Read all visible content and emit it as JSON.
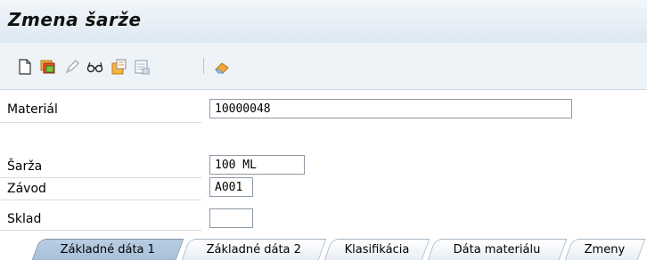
{
  "window": {
    "title": "Zmena šarže"
  },
  "toolbar": {
    "icons": [
      "new-document-icon",
      "save-icon",
      "pencil-icon",
      "glasses-icon",
      "copy-icon",
      "print-preview-icon",
      "eraser-icon"
    ]
  },
  "form": {
    "material": {
      "label": "Materiál",
      "value": "10000048"
    },
    "batch": {
      "label": "Šarža",
      "value": "100 ML"
    },
    "plant": {
      "label": "Závod",
      "value": "A001"
    },
    "storage": {
      "label": "Sklad",
      "value": ""
    }
  },
  "tabs": [
    {
      "label": "Základné dáta 1",
      "active": true
    },
    {
      "label": "Základné dáta 2",
      "active": false
    },
    {
      "label": "Klasifikácia",
      "active": false
    },
    {
      "label": "Dáta materiálu",
      "active": false
    },
    {
      "label": "Zmeny",
      "active": false
    }
  ],
  "colors": {
    "title_bg": "#dde8f2",
    "active_tab": "#a7c0d9"
  }
}
